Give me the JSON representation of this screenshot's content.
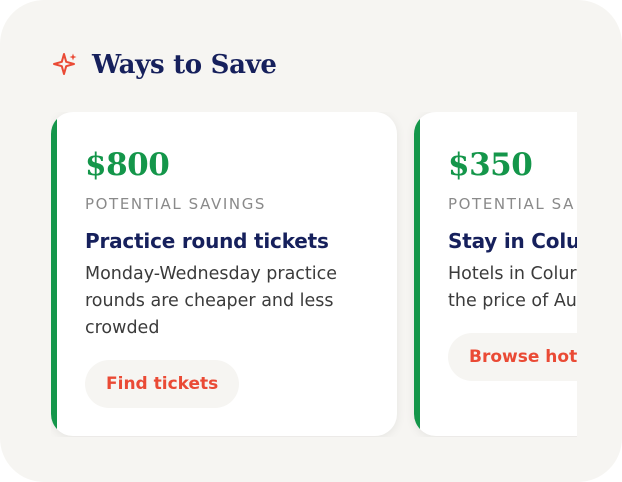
{
  "section": {
    "title": "Ways to Save",
    "icon": "sparkle-icon",
    "accent_color": "#ea4a35"
  },
  "cards": [
    {
      "amount": "$800",
      "savings_label": "POTENTIAL SAVINGS",
      "title": "Practice round tickets",
      "description": "Monday-Wednesday practice rounds are cheaper and less crowded",
      "button_label": "Find tickets"
    },
    {
      "amount": "$350",
      "savings_label": "POTENTIAL SA",
      "title": "Stay in Colu",
      "description_line1": "Hotels in Colur",
      "description_line2": "the price of Au",
      "button_label": "Browse hote"
    }
  ],
  "colors": {
    "savings_green": "#14964a",
    "navy": "#16205c",
    "button_text": "#ea4a35",
    "panel_bg": "#f6f5f2"
  }
}
